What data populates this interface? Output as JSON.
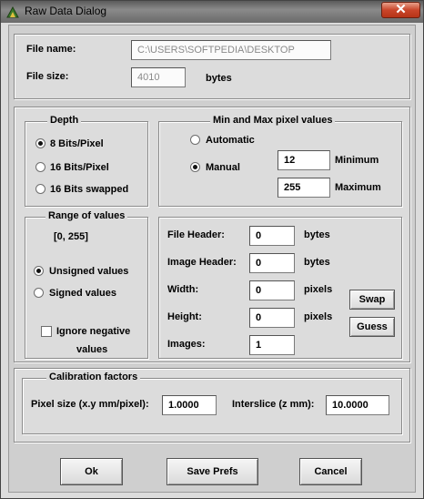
{
  "window": {
    "title": "Raw Data Dialog",
    "close_glyph": "✕",
    "icon": "app-icon"
  },
  "file": {
    "name_label": "File name:",
    "name_value": "C:\\USERS\\SOFTPEDIA\\DESKTOP",
    "size_label": "File size:",
    "size_value": "4010",
    "size_unit": "bytes"
  },
  "depth": {
    "title": "Depth",
    "options": [
      {
        "label": "8 Bits/Pixel",
        "selected": true
      },
      {
        "label": "16 Bits/Pixel",
        "selected": false
      },
      {
        "label": "16 Bits swapped",
        "selected": false
      }
    ]
  },
  "minmax": {
    "title": "Min and Max pixel values",
    "automatic_label": "Automatic",
    "manual_label": "Manual",
    "min_value": "12",
    "min_label": "Minimum",
    "max_value": "255",
    "max_label": "Maximum"
  },
  "range": {
    "title": "Range of values",
    "range_text": "[0, 255]",
    "unsigned_label": "Unsigned values",
    "signed_label": "Signed values",
    "ignore_line1": "Ignore negative",
    "ignore_line2": "values"
  },
  "header": {
    "file_header_label": "File Header:",
    "file_header_value": "0",
    "file_header_unit": "bytes",
    "image_header_label": "Image Header:",
    "image_header_value": "0",
    "image_header_unit": "bytes",
    "width_label": "Width:",
    "width_value": "0",
    "width_unit": "pixels",
    "height_label": "Height:",
    "height_value": "0",
    "height_unit": "pixels",
    "images_label": "Images:",
    "images_value": "1",
    "swap_label": "Swap",
    "guess_label": "Guess"
  },
  "calibration": {
    "title": "Calibration factors",
    "pixel_size_label": "Pixel size (x.y mm/pixel):",
    "pixel_size_value": "1.0000",
    "interslice_label": "Interslice (z mm):",
    "interslice_value": "10.0000"
  },
  "buttons": {
    "ok": "Ok",
    "save_prefs": "Save Prefs",
    "cancel": "Cancel"
  }
}
